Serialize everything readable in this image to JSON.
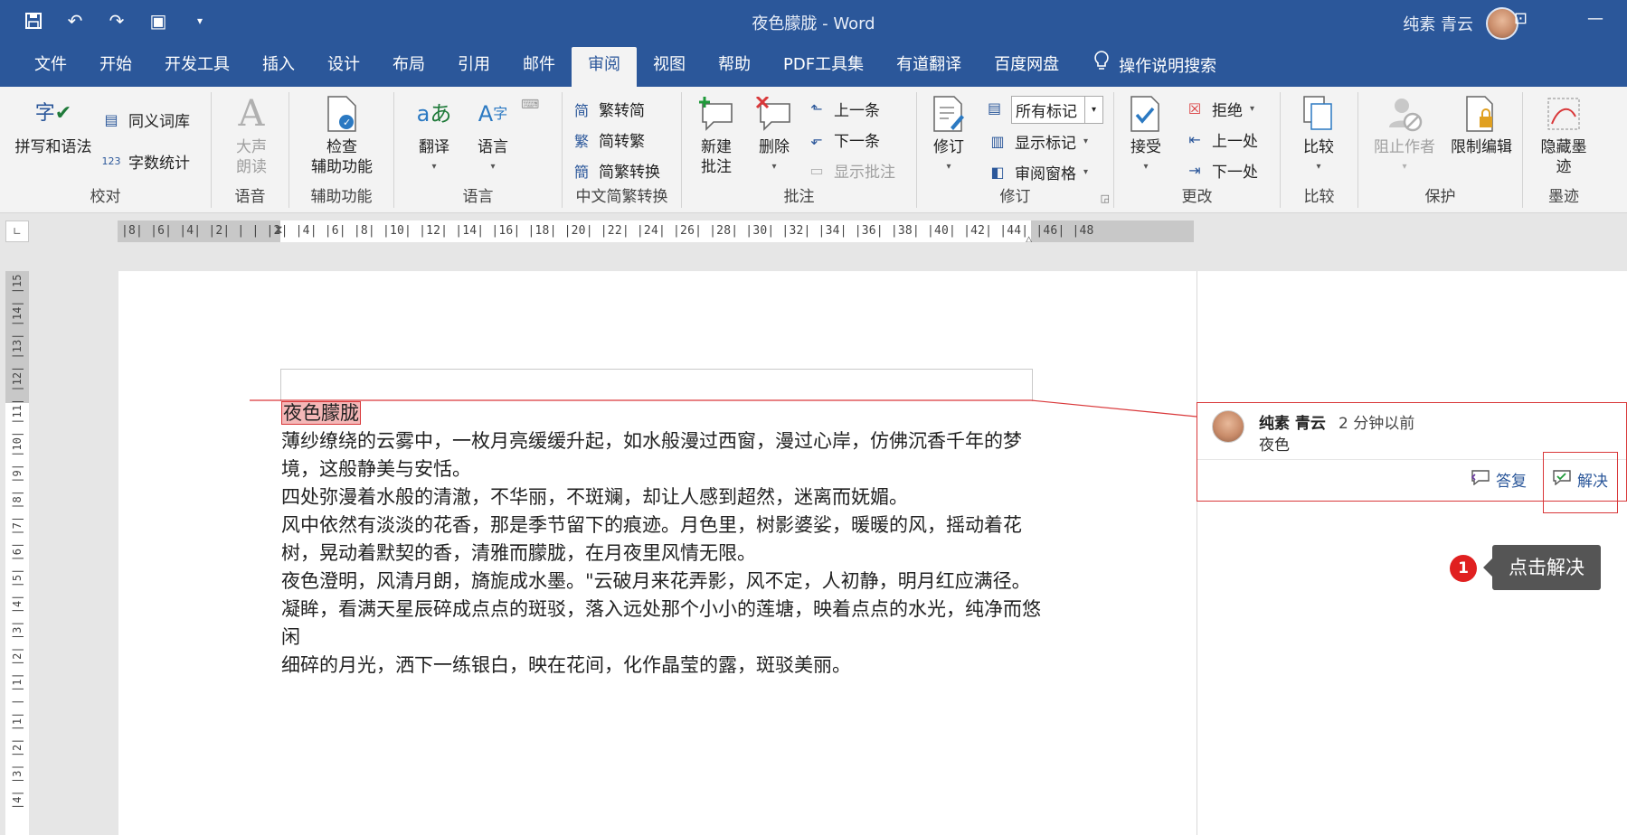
{
  "window": {
    "title": "夜色朦胧  -  Word",
    "user": "纯素 青云"
  },
  "tabs": [
    "文件",
    "开始",
    "开发工具",
    "插入",
    "设计",
    "布局",
    "引用",
    "邮件",
    "审阅",
    "视图",
    "帮助",
    "PDF工具集",
    "有道翻译",
    "百度网盘"
  ],
  "active_tab": "审阅",
  "tell_me": "操作说明搜索",
  "ribbon": {
    "proofing": {
      "label": "校对",
      "spelling": "拼写和语法",
      "thesaurus": "同义词库",
      "wordcount": "字数统计"
    },
    "speech": {
      "label": "语音",
      "readaloud_1": "大声",
      "readaloud_2": "朗读"
    },
    "accessibility": {
      "label": "辅助功能",
      "check_1": "检查",
      "check_2": "辅助功能"
    },
    "language": {
      "label": "语言",
      "translate": "翻译",
      "language": "语言"
    },
    "chinese": {
      "label": "中文简繁转换",
      "to_trad": "繁转简",
      "to_simp": "简转繁",
      "convert": "简繁转换"
    },
    "comments": {
      "label": "批注",
      "new_1": "新建",
      "new_2": "批注",
      "delete": "删除",
      "prev": "上一条",
      "next": "下一条",
      "show": "显示批注"
    },
    "tracking": {
      "label": "修订",
      "track": "修订",
      "markup": "所有标记",
      "show_markup": "显示标记",
      "pane": "审阅窗格"
    },
    "changes": {
      "label": "更改",
      "accept": "接受",
      "reject": "拒绝",
      "prev": "上一处",
      "next": "下一处"
    },
    "compare": {
      "label": "比较",
      "compare": "比较"
    },
    "protect": {
      "label": "保护",
      "block": "阻止作者",
      "restrict": "限制编辑"
    },
    "ink": {
      "label": "墨迹",
      "hide_1": "隐藏墨",
      "hide_2": "迹"
    }
  },
  "ruler": {
    "h_ticks": "|8| |6| |4| |2| |  |  |2| |4| |6| |8| |10| |12| |14| |16| |18| |20| |22| |24| |26| |28| |30| |32| |34| |36| |38| |40| |42| |44| |46| |48",
    "v_ticks": "|4| |3| |2| |1| |  |1| |2| |3| |4| |5| |6| |7| |8| |9| |10| |11| |12| |13| |14| |15"
  },
  "document": {
    "title": "夜色朦胧",
    "paragraphs": [
      "薄纱缭绕的云雾中，一枚月亮缓缓升起，如水般漫过西窗，漫过心岸，仿佛沉香千年的梦境，这般静美与安恬。",
      "四处弥漫着水般的清澈，不华丽，不斑斓，却让人感到超然，迷离而妩媚。",
      "风中依然有淡淡的花香，那是季节留下的痕迹。月色里，树影婆娑，暖暖的风，摇动着花树，晃动着默契的香，清雅而朦胧，在月夜里风情无限。",
      "夜色澄明，风清月朗，旖旎成水墨。\"云破月来花弄影，风不定，人初静，明月红应满径。",
      "凝眸，看满天星辰碎成点点的斑驳，落入远处那个小小的莲塘，映着点点的水光，纯净而悠闲",
      "细碎的月光，洒下一练银白，映在花间，化作晶莹的露，斑驳美丽。"
    ]
  },
  "comment": {
    "author": "纯素 青云",
    "time": "2 分钟以前",
    "text": "夜色",
    "reply": "答复",
    "resolve": "解决"
  },
  "annotation": {
    "step": "1",
    "tip": "点击解决"
  },
  "colors": {
    "accent": "#2b579a",
    "highlight": "#f4b7b7",
    "marker": "#d9383a"
  }
}
